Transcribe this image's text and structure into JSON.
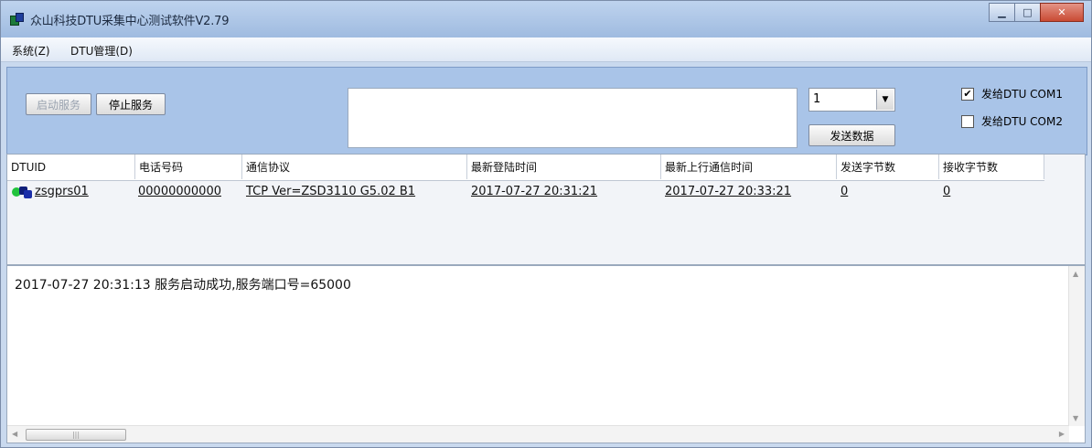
{
  "window": {
    "title": "众山科技DTU采集中心测试软件V2.79",
    "icon": "app-icon",
    "controls": [
      "minimize-icon",
      "maximize-icon",
      "close-icon"
    ]
  },
  "menu": {
    "items": [
      {
        "label": "系统(Z)"
      },
      {
        "label": "DTU管理(D)"
      }
    ]
  },
  "toolbar": {
    "start_service": "启动服务",
    "stop_service": "停止服务",
    "send_text_value": "",
    "combo_value": "1",
    "send_button": "发送数据",
    "checkboxes": [
      {
        "label": "发给DTU COM1",
        "checked": true
      },
      {
        "label": "发给DTU COM2",
        "checked": false
      }
    ]
  },
  "grid": {
    "columns": [
      "DTUID",
      "电话号码",
      "通信协议",
      "最新登陆时间",
      "最新上行通信时间",
      "发送字节数",
      "接收字节数"
    ],
    "rows": [
      {
        "dtuid": "zsgprs01",
        "phone": "00000000000",
        "protocol": "TCP Ver=ZSD3110 G5.02 B1",
        "login_time": "2017-07-27 20:31:21",
        "uplink_time": "2017-07-27 20:33:21",
        "sent_bytes": "0",
        "recv_bytes": "0",
        "status_icon": "online-status-icon"
      }
    ]
  },
  "log": {
    "lines": [
      "2017-07-27 20:31:13 服务启动成功,服务端口号=65000"
    ]
  },
  "colors": {
    "toolbar_bg": "#a9c4e8",
    "online_green": "#22c33d"
  }
}
